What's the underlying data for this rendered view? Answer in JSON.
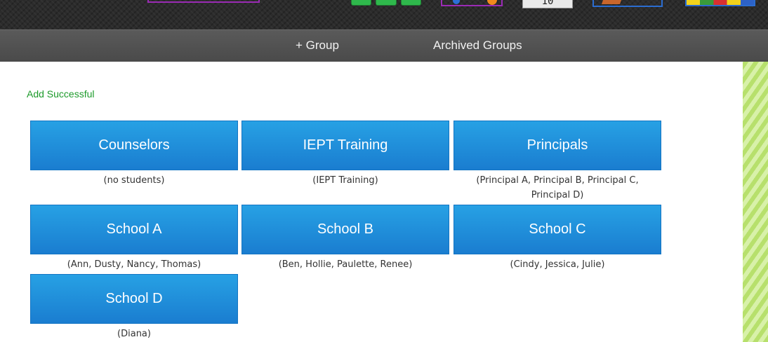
{
  "top_banner": {
    "counter_value": "10"
  },
  "nav": {
    "add_group_label": "+ Group",
    "archived_groups_label": "Archived Groups"
  },
  "status": {
    "message": "Add Successful",
    "color": "#1c9a2a"
  },
  "colors": {
    "group_button": "#1f8cdb",
    "nav_bar": "#4f4f4f",
    "stripe": "#c9ea8c"
  },
  "groups": [
    {
      "name": "Counselors",
      "members": "(no students)"
    },
    {
      "name": "IEPT Training",
      "members": "(IEPT Training)"
    },
    {
      "name": "Principals",
      "members": "(Principal A, Principal B, Principal C, Principal D)"
    },
    {
      "name": "School A",
      "members": "(Ann, Dusty, Nancy, Thomas)"
    },
    {
      "name": "School B",
      "members": "(Ben, Hollie, Paulette, Renee)"
    },
    {
      "name": "School C",
      "members": "(Cindy, Jessica, Julie)"
    },
    {
      "name": "School D",
      "members": "(Diana)"
    }
  ]
}
